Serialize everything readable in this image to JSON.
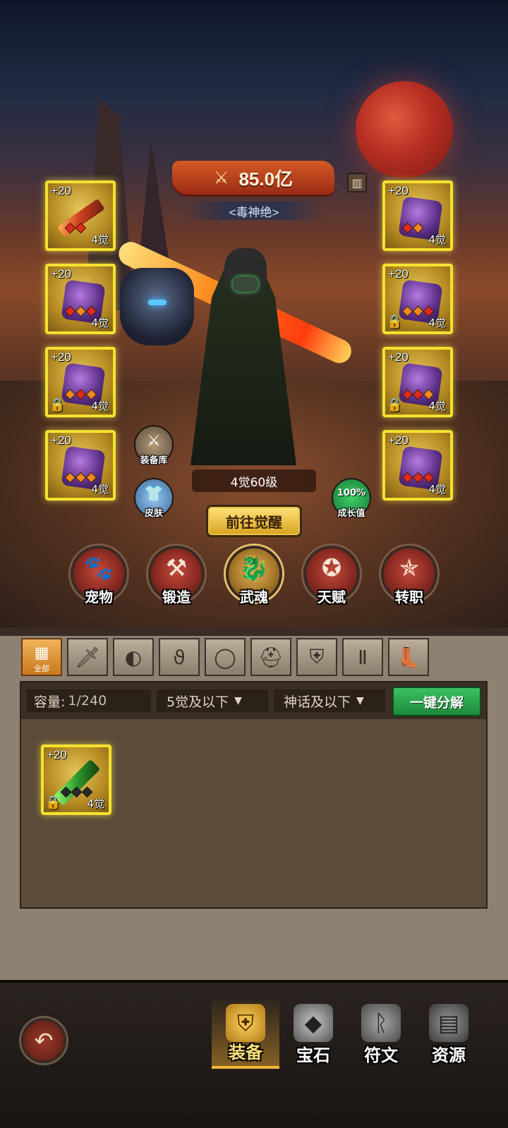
{
  "header": {
    "power_value": "85.0亿",
    "title": "<毒神绝>",
    "icons": {
      "power": "crossed-swords-icon",
      "rank": "ranking-icon"
    }
  },
  "equipment_slots": {
    "left": [
      {
        "level": "+20",
        "awaken": "4觉",
        "item": "flame-sword",
        "gems": [
          "red",
          "red"
        ],
        "locked": false
      },
      {
        "level": "+20",
        "awaken": "4觉",
        "item": "purple-gauntlet",
        "gems": [
          "red",
          "orange",
          "red"
        ],
        "locked": false
      },
      {
        "level": "+20",
        "awaken": "4觉",
        "item": "chain-necklace",
        "gems": [
          "orange",
          "red",
          "orange"
        ],
        "locked": true
      },
      {
        "level": "+20",
        "awaken": "4觉",
        "item": "purple-ring",
        "gems": [
          "orange",
          "orange",
          "orange"
        ],
        "locked": false
      }
    ],
    "right": [
      {
        "level": "+20",
        "awaken": "4觉",
        "item": "spiked-helmet",
        "gems": [
          "red",
          "orange"
        ],
        "locked": false
      },
      {
        "level": "+20",
        "awaken": "4觉",
        "item": "crystal-armor",
        "gems": [
          "orange",
          "orange",
          "red"
        ],
        "locked": true
      },
      {
        "level": "+20",
        "awaken": "4觉",
        "item": "crystal-greaves",
        "gems": [
          "red",
          "red",
          "orange"
        ],
        "locked": true
      },
      {
        "level": "+20",
        "awaken": "4觉",
        "item": "crystal-boots",
        "gems": [
          "red",
          "red",
          "red"
        ],
        "locked": false
      }
    ]
  },
  "hero": {
    "level_text": "4觉60级",
    "awaken_button": "前往觉醒"
  },
  "side_buttons": {
    "armory": "装备库",
    "skin": "皮肤",
    "growth_pct": "100%",
    "growth_label": "成长值"
  },
  "features": [
    "宠物",
    "锻造",
    "武魂",
    "天赋",
    "转职"
  ],
  "categories": {
    "all_label": "全部",
    "tabs": [
      "all",
      "weapon",
      "shoulder",
      "necklace",
      "ring",
      "helmet",
      "armor",
      "legs",
      "boots"
    ],
    "active": "all"
  },
  "bag": {
    "capacity_label": "容量:",
    "capacity_value": "1/240",
    "filter_awaken": "5觉及以下",
    "filter_quality": "神话及以下",
    "decompose_button": "一键分解",
    "items": [
      {
        "level": "+20",
        "awaken": "4觉",
        "item": "green-blade",
        "gems": [
          "dark",
          "dark",
          "dark"
        ],
        "locked": true
      }
    ]
  },
  "bottom_nav": {
    "back_icon": "back-arrow-icon",
    "items": [
      "装备",
      "宝石",
      "符文",
      "资源"
    ],
    "active": "装备"
  },
  "colors": {
    "slot_border": "#f5e12e",
    "decompose_green": "#2aa04a",
    "awaken_gold": "#e9c44a",
    "active_nav": "#f5b63a"
  }
}
